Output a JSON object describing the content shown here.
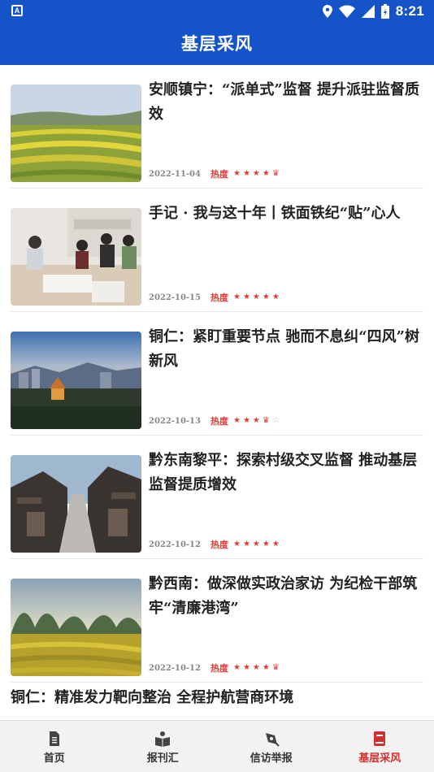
{
  "status_bar": {
    "time": "8:21",
    "app_badge": "A"
  },
  "app_bar": {
    "title": "基层采风"
  },
  "articles": [
    {
      "title": "安顺镇宁：“派单式”监督 提升派驻监督质效",
      "date": "2022-11-04",
      "hot_label": "热度",
      "heat_rating": 4.5
    },
    {
      "title": "手记 · 我与这十年丨铁面铁纪“贴”心人",
      "date": "2022-10-15",
      "hot_label": "热度",
      "heat_rating": 5
    },
    {
      "title": "铜仁：紧盯重要节点 驰而不息纠“四风”树新风",
      "date": "2022-10-13",
      "hot_label": "热度",
      "heat_rating": 3.5
    },
    {
      "title": "黔东南黎平：探索村级交叉监督 推动基层监督提质增效",
      "date": "2022-10-12",
      "hot_label": "热度",
      "heat_rating": 5
    },
    {
      "title": "黔西南：做深做实政治家访 为纪检干部筑牢“清廉港湾”",
      "date": "2022-10-12",
      "hot_label": "热度",
      "heat_rating": 4.5
    }
  ],
  "partial_article": {
    "title": "铜仁：精准发力靶向整治 全程护航营商环境"
  },
  "tab_bar": {
    "tabs": [
      {
        "label": "首页",
        "icon": "document-icon",
        "active": false
      },
      {
        "label": "报刊汇",
        "icon": "book-icon",
        "active": false
      },
      {
        "label": "信访举报",
        "icon": "pen-icon",
        "active": false
      },
      {
        "label": "基层采风",
        "icon": "notebook-icon",
        "active": true
      }
    ]
  },
  "colors": {
    "primary": "#1554c8",
    "accent_red": "#e53935",
    "active_tab": "#d32f2f"
  }
}
